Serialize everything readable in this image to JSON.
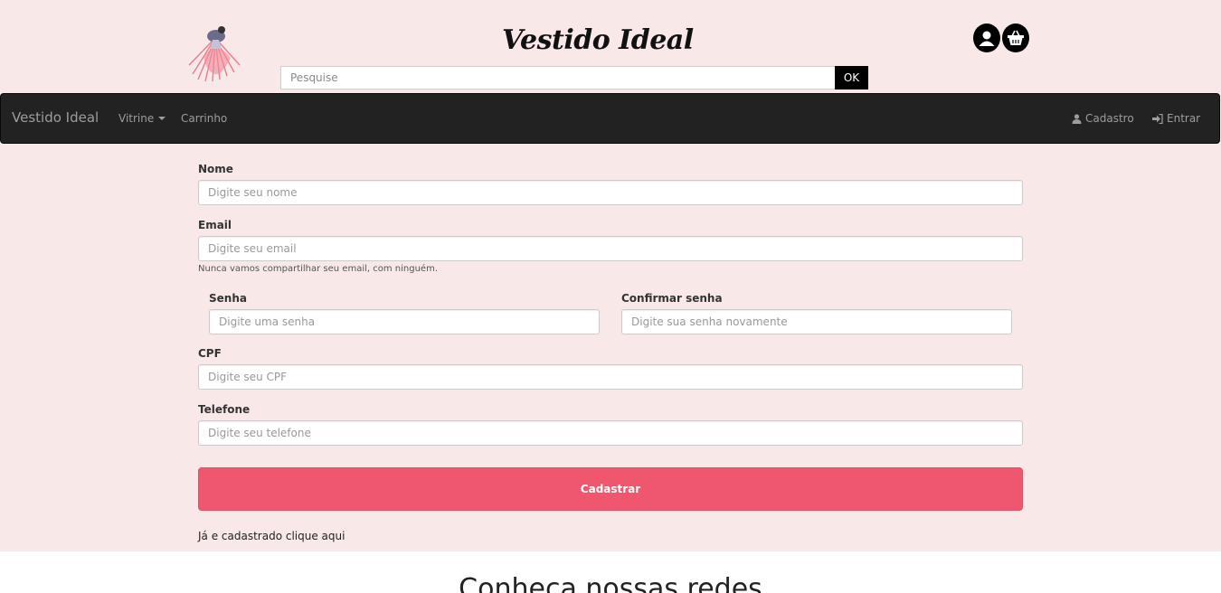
{
  "header": {
    "brand_title": "Vestido Ideal",
    "search": {
      "placeholder": "Pesquise",
      "button_label": "OK"
    }
  },
  "navbar": {
    "brand": "Vestido Ideal",
    "items": [
      {
        "label": "Vitrine"
      },
      {
        "label": "Carrinho"
      }
    ],
    "right_items": [
      {
        "label": "Cadastro",
        "icon": "user-icon"
      },
      {
        "label": "Entrar",
        "icon": "sign-in-icon"
      }
    ]
  },
  "form": {
    "nome": {
      "label": "Nome",
      "placeholder": "Digite seu nome"
    },
    "email": {
      "label": "Email",
      "placeholder": "Digite seu email",
      "help": "Nunca vamos compartilhar seu email, com ninguém."
    },
    "senha": {
      "label": "Senha",
      "placeholder": "Digite uma senha"
    },
    "confirmar_senha": {
      "label": "Confirmar senha",
      "placeholder": "Digite sua senha novamente"
    },
    "cpf": {
      "label": "CPF",
      "placeholder": "Digite seu CPF"
    },
    "telefone": {
      "label": "Telefone",
      "placeholder": "Digite seu telefone"
    },
    "submit_label": "Cadastrar",
    "login_link": "Já e cadastrado clique aqui"
  },
  "footer": {
    "title": "Conheca nossas redes"
  },
  "colors": {
    "page_bg": "#f8e8e8",
    "navbar_bg": "#222222",
    "accent": "#ee576d"
  }
}
